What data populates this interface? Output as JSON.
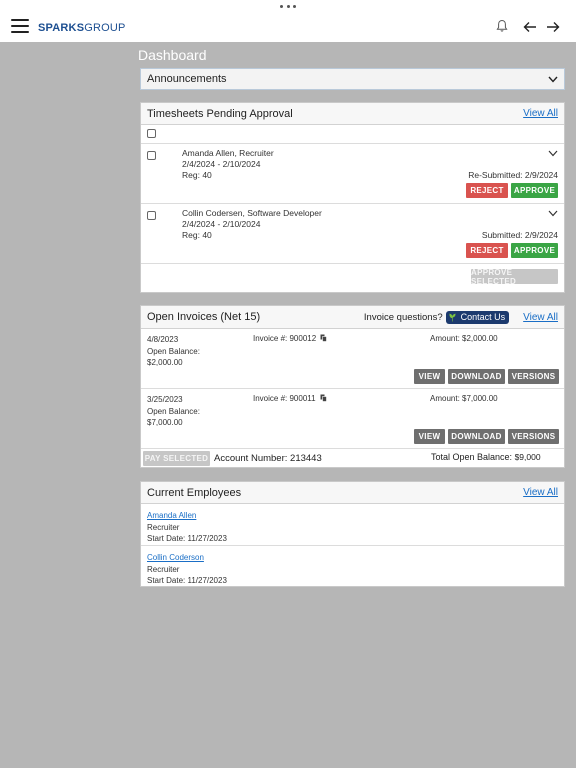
{
  "header": {
    "logo_bold": "SPARKS",
    "logo_light": "GROUP"
  },
  "page": {
    "title": "Dashboard"
  },
  "announcements": {
    "title": "Announcements"
  },
  "timesheets": {
    "title": "Timesheets Pending Approval",
    "view_all": "View All",
    "rows": [
      {
        "name": "Amanda Allen, Recruiter",
        "period": "2/4/2024 - 2/10/2024",
        "reg": "Reg: 40",
        "status": "Re-Submitted: 2/9/2024",
        "reject": "REJECT",
        "approve": "APPROVE"
      },
      {
        "name": "Collin Codersen, Software Developer",
        "period": "2/4/2024 - 2/10/2024",
        "reg": "Reg: 40",
        "status": "Submitted: 2/9/2024",
        "reject": "REJECT",
        "approve": "APPROVE"
      }
    ],
    "approve_selected": "APPROVE SELECTED"
  },
  "invoices": {
    "title": "Open Invoices (Net 15)",
    "questions": "Invoice questions?",
    "contact_us": "Contact Us",
    "view_all": "View All",
    "rows": [
      {
        "date": "4/8/2023",
        "balance_label": "Open Balance:",
        "balance": "$2,000.00",
        "invoice": "Invoice #: 900012",
        "amount": "Amount: $2,000.00"
      },
      {
        "date": "3/25/2023",
        "balance_label": "Open Balance:",
        "balance": "$7,000.00",
        "invoice": "Invoice #: 900011",
        "amount": "Amount: $7,000.00"
      }
    ],
    "actions": {
      "view": "VIEW",
      "download": "DOWNLOAD",
      "versions": "VERSIONS"
    },
    "pay_selected": "PAY SELECTED",
    "account_number": "Account Number: 213443",
    "total_label": "Total Open Balance:",
    "total_value": "$9,000"
  },
  "employees": {
    "title": "Current Employees",
    "view_all": "View All",
    "rows": [
      {
        "name": "Amanda Allen",
        "role": "Recruiter",
        "start": "Start Date: 11/27/2023"
      },
      {
        "name": "Collin Coderson",
        "role": "Recruiter",
        "start": "Start Date: 11/27/2023"
      }
    ]
  },
  "icons": {
    "menu": "hamburger-icon",
    "bell": "bell-icon",
    "back": "arrow-left-icon",
    "forward": "arrow-right-icon",
    "expand": "chevron-down-icon",
    "copy": "copy-icon",
    "leaf": "leaf-icon"
  },
  "colors": {
    "background": "#b6b6b6",
    "brand": "#1d4f91",
    "link": "#1a6ec6",
    "reject": "#d9534f",
    "approve": "#3aa545",
    "contact": "#1c3a6e"
  }
}
